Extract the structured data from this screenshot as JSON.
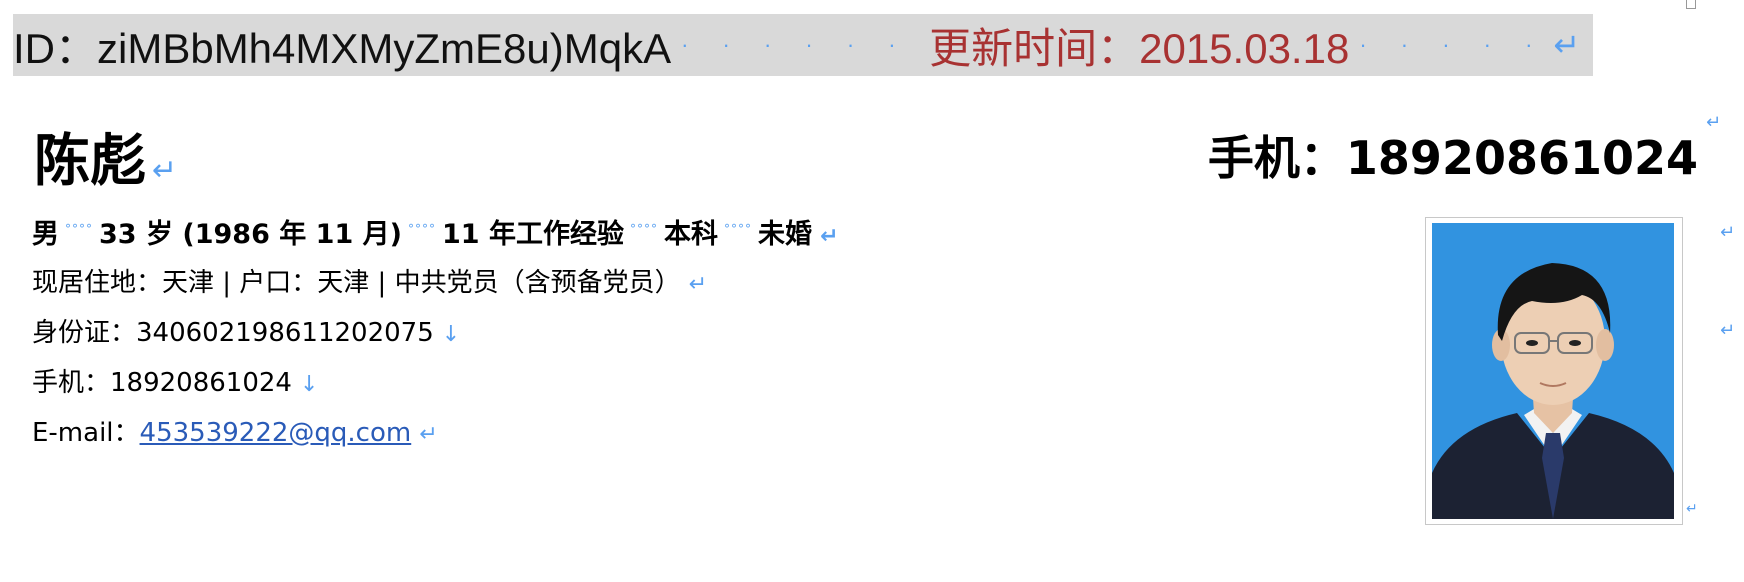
{
  "header": {
    "resume_id": "ID：ziMBbMh4MXMyZmE8u)MqkA",
    "update_time": "更新时间：2015.03.18",
    "dot_fill": "· · · · · · · · · · · · · · · · · · · ·"
  },
  "profile": {
    "name": "陈彪",
    "phone_headline": "手机：18920861024",
    "basic_info": {
      "gender": "男",
      "age": "33 岁 (1986 年 11 月)",
      "experience": "11 年工作经验",
      "education": "本科",
      "marital": "未婚"
    },
    "residence_line": "现居住地：天津 | 户口：天津 | 中共党员（含预备党员）",
    "id_card": "身份证：340602198611202075",
    "mobile": "手机：18920861024",
    "email_label": "E-mail：",
    "email": "453539222@qq.com"
  },
  "marks": {
    "paragraph": "↵",
    "line_break": "↓",
    "space_dot": "·",
    "wide_space": "°°°°"
  },
  "colors": {
    "header_band": "#d9d9d9",
    "update_time": "#a83232",
    "formatting_marks": "#5aa0f0",
    "link": "#2a5bb8",
    "photo_background": "#2f8fdf"
  }
}
